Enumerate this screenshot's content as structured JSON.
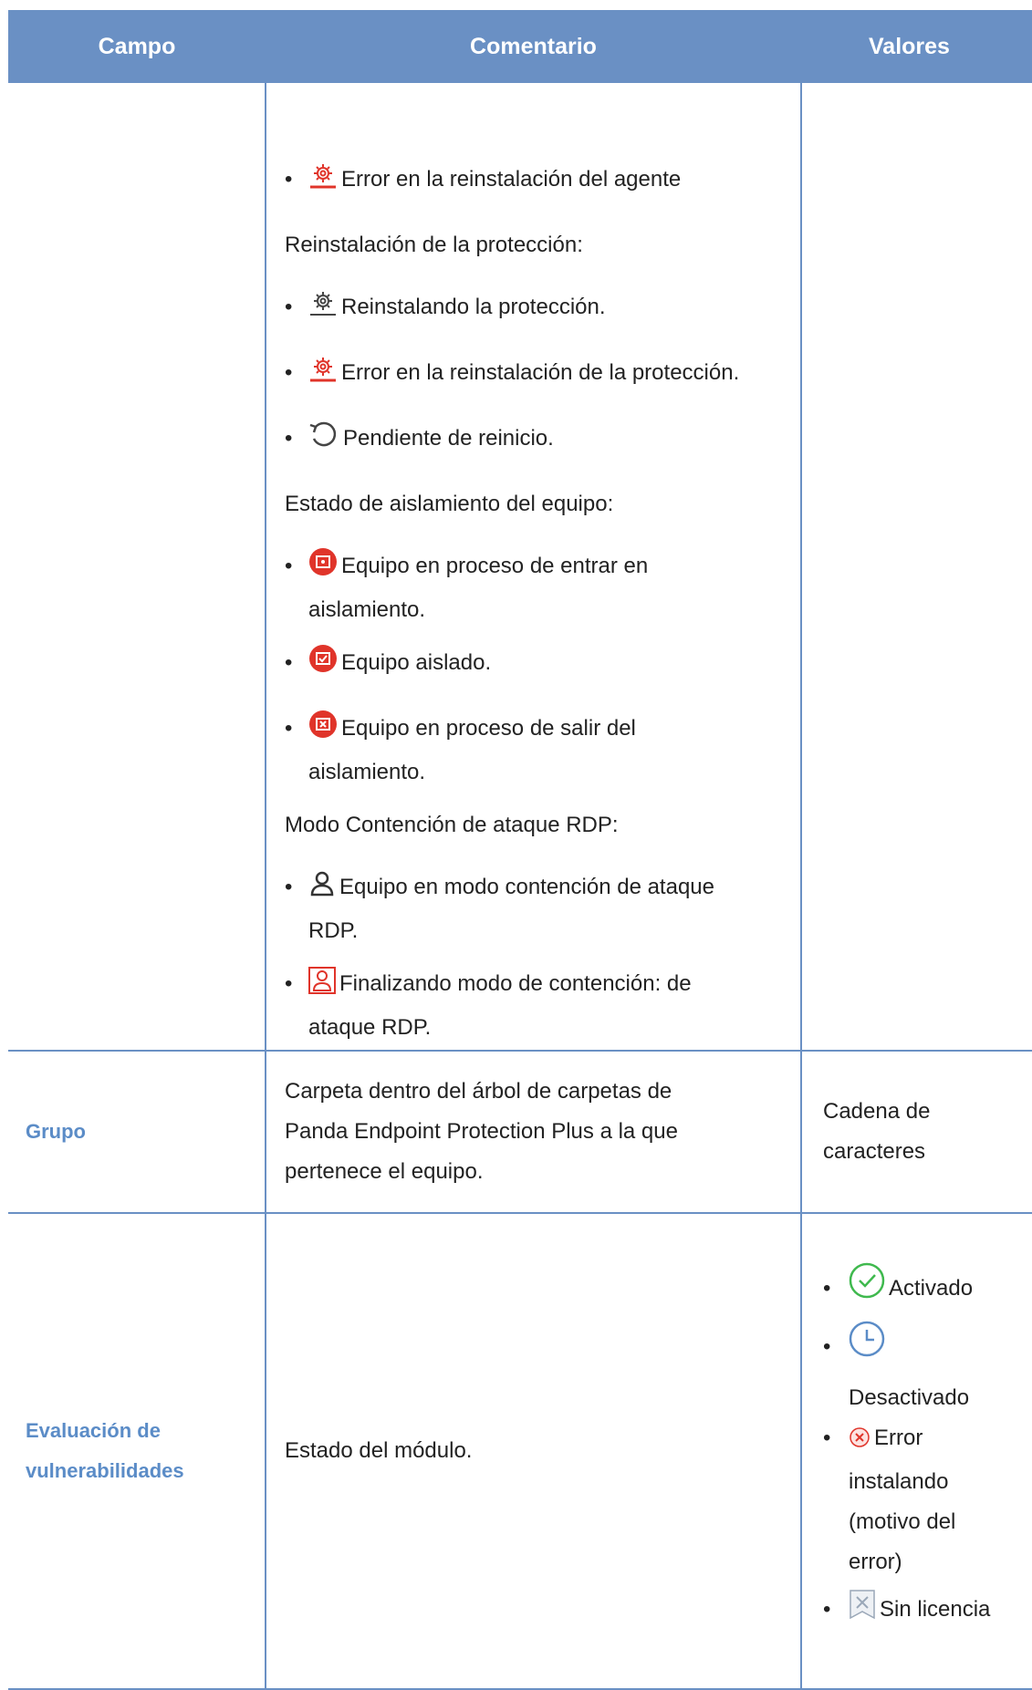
{
  "header": {
    "col1": "Campo",
    "col2": "Comentario",
    "col3": "Valores"
  },
  "row1": {
    "items": [
      "Error en la reinstalación del agente",
      "Reinstalación de la protección:",
      "Reinstalando la protección.",
      "Error en la reinstalación de la protección.",
      "Pendiente de reinicio.",
      "Estado de aislamiento del equipo:",
      "Equipo en proceso de entrar en",
      "aislamiento.",
      "Equipo aislado.",
      "Equipo en proceso de salir del",
      "aislamiento.",
      "Modo Contención de ataque RDP:",
      "Equipo en modo contención de ataque",
      "RDP.",
      "Finalizando modo de contención: de",
      "ataque RDP."
    ]
  },
  "row2": {
    "field": "Grupo",
    "comment": [
      "Carpeta dentro del árbol de carpetas de",
      "Panda Endpoint Protection Plus a la que",
      "pertenece el equipo."
    ],
    "values": [
      "Cadena de",
      "caracteres"
    ]
  },
  "row3": {
    "field": [
      "Evaluación de",
      "vulnerabilidades"
    ],
    "comment": "Estado del módulo.",
    "values": [
      "Activado",
      "Desactivado",
      "Error",
      "instalando",
      "(motivo del",
      "error)",
      "Sin licencia"
    ]
  },
  "colors": {
    "header_bg": "#6a90c4",
    "field_text": "#5b8cc7",
    "error_red": "#e0342a",
    "ok_green": "#3fb94e",
    "clock_blue": "#5b8cc7"
  }
}
